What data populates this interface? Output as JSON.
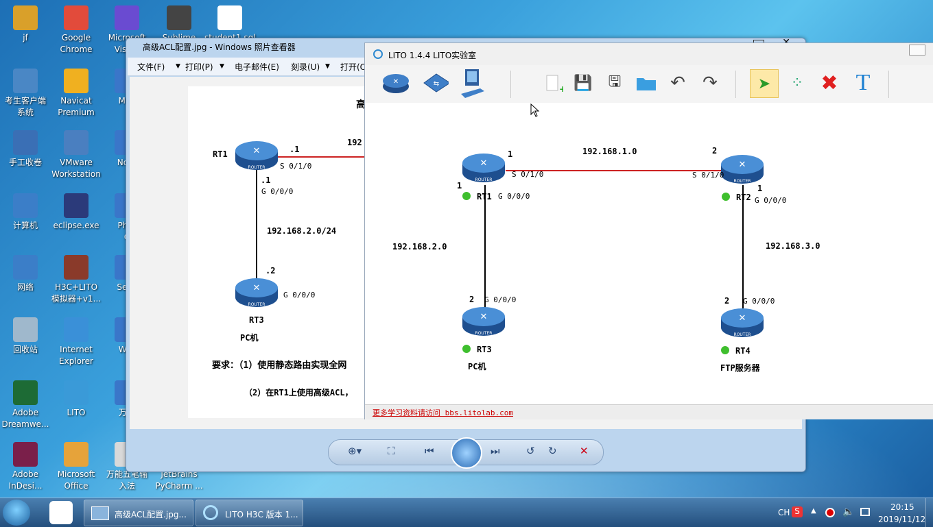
{
  "desktop": {
    "icons": [
      {
        "label": "jf",
        "line2": ""
      },
      {
        "label": "Google",
        "line2": "Chrome"
      },
      {
        "label": "Microsoft",
        "line2": "Visu..."
      },
      {
        "label": "Sublime",
        "line2": ""
      },
      {
        "label": "student1.sql",
        "line2": ""
      },
      {
        "label": "考生客户端",
        "line2": "系统"
      },
      {
        "label": "Navicat",
        "line2": "Premium"
      },
      {
        "label": "MyE",
        "line2": ""
      },
      {
        "label": "手工收卷",
        "line2": ""
      },
      {
        "label": "VMware",
        "line2": "Workstation"
      },
      {
        "label": "Note",
        "line2": ""
      },
      {
        "label": "计算机",
        "line2": ""
      },
      {
        "label": "eclipse.exe",
        "line2": ""
      },
      {
        "label": "Phot",
        "line2": "C"
      },
      {
        "label": "网络",
        "line2": ""
      },
      {
        "label": "H3C+LITO",
        "line2": "模拟器+v1..."
      },
      {
        "label": "Secu",
        "line2": ""
      },
      {
        "label": "回收站",
        "line2": ""
      },
      {
        "label": "Internet",
        "line2": "Explorer"
      },
      {
        "label": "WIN",
        "line2": ""
      },
      {
        "label": "Adobe",
        "line2": "Dreamwe..."
      },
      {
        "label": "LITO",
        "line2": ""
      },
      {
        "label": "万能",
        "line2": ""
      },
      {
        "label": "Adobe",
        "line2": "InDesi..."
      },
      {
        "label": "Microsoft",
        "line2": "Office"
      },
      {
        "label": "万能五笔输",
        "line2": "入法"
      },
      {
        "label": "JetBrains",
        "line2": "PyCharm ..."
      }
    ]
  },
  "photo_viewer": {
    "title": "高级ACL配置.jpg - Windows 照片查看器",
    "menu": [
      "文件(F)",
      "打印(P)",
      "电子邮件(E)",
      "刻录(U)",
      "打开(O"
    ],
    "doc": {
      "heading": "高",
      "rt1": "RT1",
      "rt1_dot1": ".1",
      "rt1_s": "S 0/1/0",
      "rt1_dot1b": ".1",
      "rt1_g": "G 0/0/0",
      "net_top": "192",
      "net_left": "192.168.2.0/24",
      "rt3_dot2": ".2",
      "rt3_g": "G 0/0/0",
      "rt3": "RT3",
      "pc": "PC机",
      "req1": "要求：（1）使用静态路由实现全网",
      "req2": "（2）在RT1上使用高级ACL，"
    },
    "controls": [
      "zoom-icon",
      "fit-icon",
      "prev-icon",
      "slideshow-icon",
      "next-icon",
      "rotate-left-icon",
      "rotate-right-icon",
      "delete-icon"
    ]
  },
  "lito": {
    "title": "LITO 1.4.4  LITO实验室",
    "toolbar": [
      "router-icon",
      "switch-icon",
      "pc-icon",
      "new-icon",
      "save-icon",
      "save-as-icon",
      "open-icon",
      "undo-icon",
      "redo-icon",
      "select-icon",
      "connect-icon",
      "delete-icon",
      "text-icon"
    ],
    "topology": {
      "rt1": "RT1",
      "rt1_g": "G 0/0/0",
      "rt1_s": "S 0/1/0",
      "rt1_num_top": "1",
      "rt1_num_left": "1",
      "net_top": "192.168.1.0",
      "rt2": "RT2",
      "rt2_g": "G 0/0/0",
      "rt2_s": "S 0/1/0",
      "rt2_num_top": "2",
      "rt2_num_right": "1",
      "net_left": "192.168.2.0",
      "net_right": "192.168.3.0",
      "rt3": "RT3",
      "rt3_g": "G 0/0/0",
      "rt3_num": "2",
      "pc": "PC机",
      "rt4": "RT4",
      "rt4_g": "G 0/0/0",
      "rt4_num": "2",
      "ftp": "FTP服务器",
      "router_tag": "ROUTER"
    },
    "status": "更多学习资料请访问 bbs.litolab.com"
  },
  "taskbar": {
    "buttons": [
      "高级ACL配置.jpg...",
      "LITO H3C 版本 1..."
    ],
    "lang": "CH",
    "time": "20:15",
    "date": "2019/11/12"
  }
}
